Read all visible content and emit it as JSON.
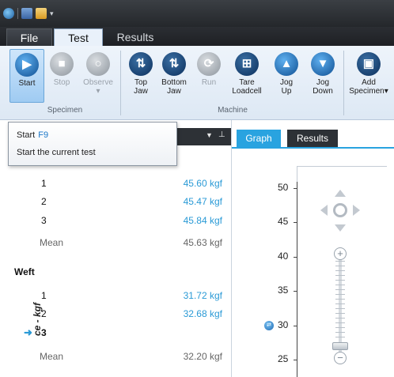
{
  "ribbon": {
    "tabs": {
      "file": "File",
      "test": "Test",
      "results": "Results"
    },
    "buttons": {
      "start": "Start",
      "stop": "Stop",
      "observe": "Observe",
      "top_jaw": [
        "Top",
        "Jaw"
      ],
      "bottom_jaw": [
        "Bottom",
        "Jaw"
      ],
      "run": "Run",
      "tare_loadcell": [
        "Tare",
        "Loadcell"
      ],
      "jog_up": [
        "Jog",
        "Up"
      ],
      "jog_down": [
        "Jog",
        "Down"
      ],
      "add_specimen": [
        "Add",
        "Specimen"
      ]
    },
    "groups": {
      "specimen": "Specimen",
      "machine": "Machine"
    }
  },
  "tooltip": {
    "title": "Start",
    "shortcut": "F9",
    "description": "Start the current test"
  },
  "results_list": {
    "warp_rows": [
      {
        "num": "1",
        "val": "45.60 kgf"
      },
      {
        "num": "2",
        "val": "45.47 kgf"
      },
      {
        "num": "3",
        "val": "45.84 kgf"
      }
    ],
    "warp_mean": {
      "label": "Mean",
      "val": "45.63 kgf"
    },
    "weft_title": "Weft",
    "weft_rows": [
      {
        "num": "1",
        "val": "31.72 kgf"
      },
      {
        "num": "2",
        "val": "32.68 kgf"
      },
      {
        "num": "3",
        "val": ""
      }
    ],
    "weft_mean": {
      "label": "Mean",
      "val": "32.20 kgf"
    }
  },
  "graph_panel": {
    "tabs": {
      "graph": "Graph",
      "results": "Results"
    },
    "y_label": "ce - kgf",
    "y_ticks": [
      "50",
      "45",
      "40",
      "35",
      "30",
      "25"
    ]
  },
  "colors": {
    "accent": "#29a3e0",
    "value_text": "#2a9ad6",
    "dark_bar": "#2d3136"
  }
}
